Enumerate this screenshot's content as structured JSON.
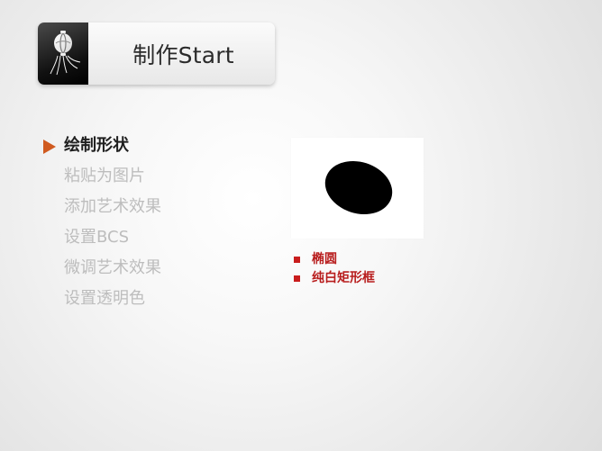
{
  "header": {
    "title": "制作Start",
    "icon": "lantern-icon"
  },
  "menu": {
    "items": [
      {
        "label": "绘制形状",
        "active": true
      },
      {
        "label": "粘贴为图片",
        "active": false
      },
      {
        "label": "添加艺术效果",
        "active": false
      },
      {
        "label": "设置BCS",
        "active": false
      },
      {
        "label": "微调艺术效果",
        "active": false
      },
      {
        "label": "设置透明色",
        "active": false
      }
    ]
  },
  "preview": {
    "shape": "black-ellipse",
    "background": "#FFFFFF"
  },
  "bullets": {
    "items": [
      "椭圆",
      "纯白矩形框"
    ]
  },
  "colors": {
    "accent_arrow": "#D05A1F",
    "bullet_red": "#C91D1D",
    "active_text": "#1F1F1F",
    "inactive_text": "#BDBDBD"
  }
}
